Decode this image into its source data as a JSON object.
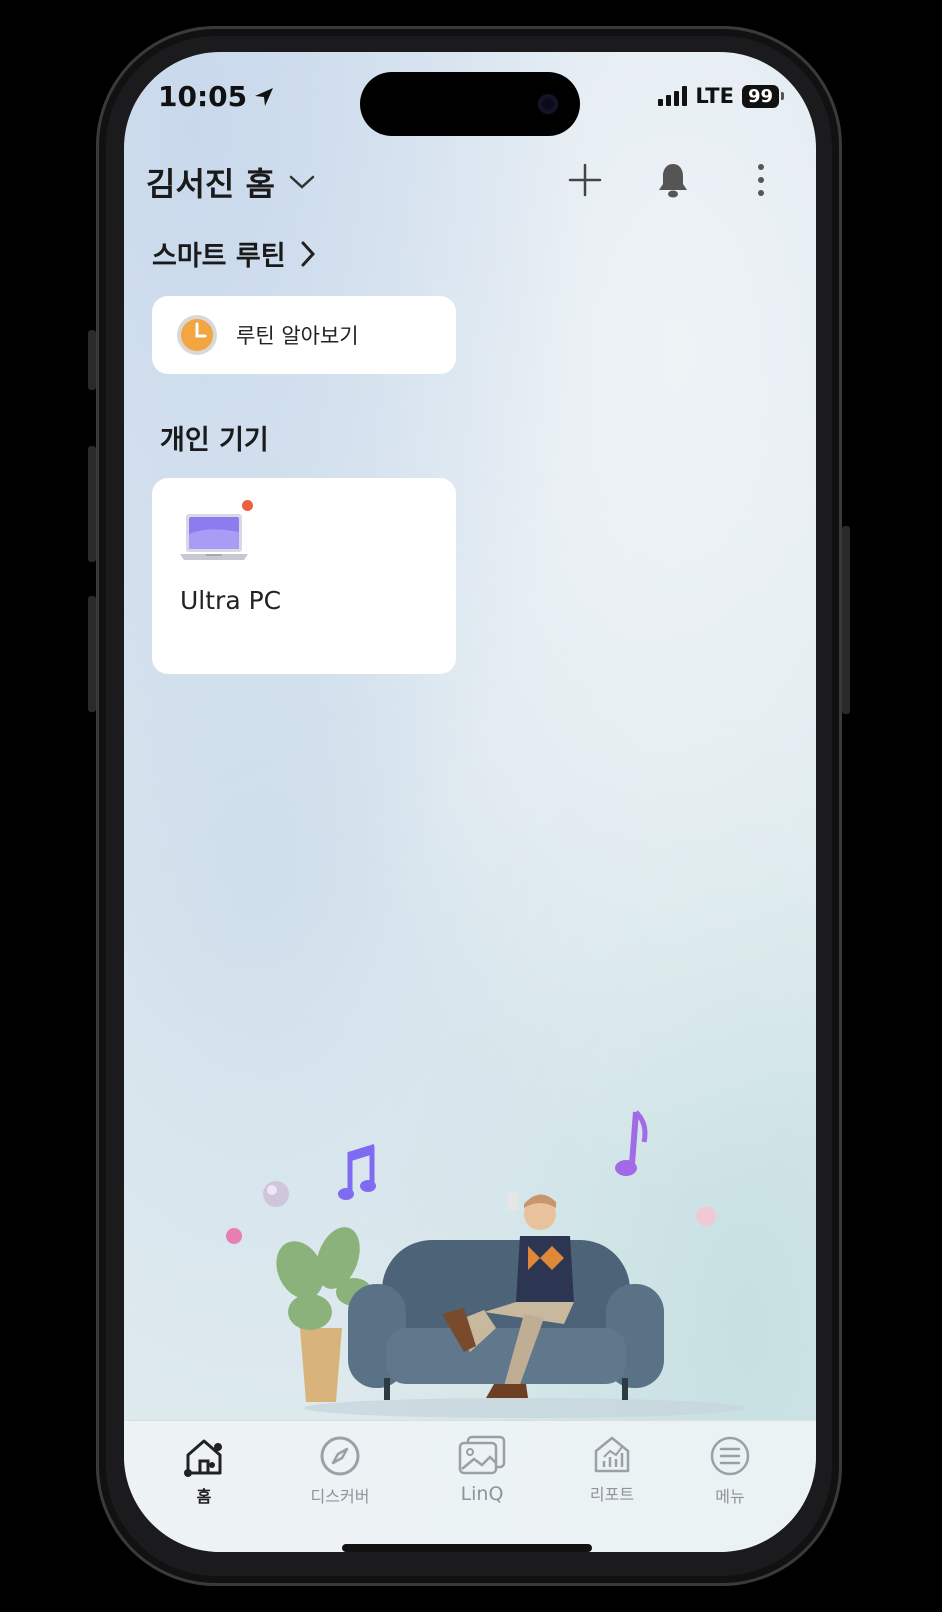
{
  "status_bar": {
    "time": "10:05",
    "network": "LTE",
    "battery": "99"
  },
  "header": {
    "title": "김서진 홈"
  },
  "routine": {
    "section_title": "스마트 루틴",
    "card_label": "루틴 알아보기"
  },
  "devices": {
    "section_title": "개인 기기",
    "items": [
      {
        "name": "Ultra PC",
        "icon": "laptop-icon",
        "has_notification": true
      }
    ]
  },
  "tabs": [
    {
      "label": "홈",
      "icon": "home-icon",
      "active": true
    },
    {
      "label": "디스커버",
      "icon": "compass-icon",
      "active": false
    },
    {
      "label": "LinQ",
      "icon": "gallery-icon",
      "active": false
    },
    {
      "label": "리포트",
      "icon": "report-icon",
      "active": false
    },
    {
      "label": "메뉴",
      "icon": "menu-icon",
      "active": false
    }
  ],
  "colors": {
    "accent": "#e9613f",
    "text": "#1a1a1a",
    "tab_inactive": "#8e9499"
  }
}
